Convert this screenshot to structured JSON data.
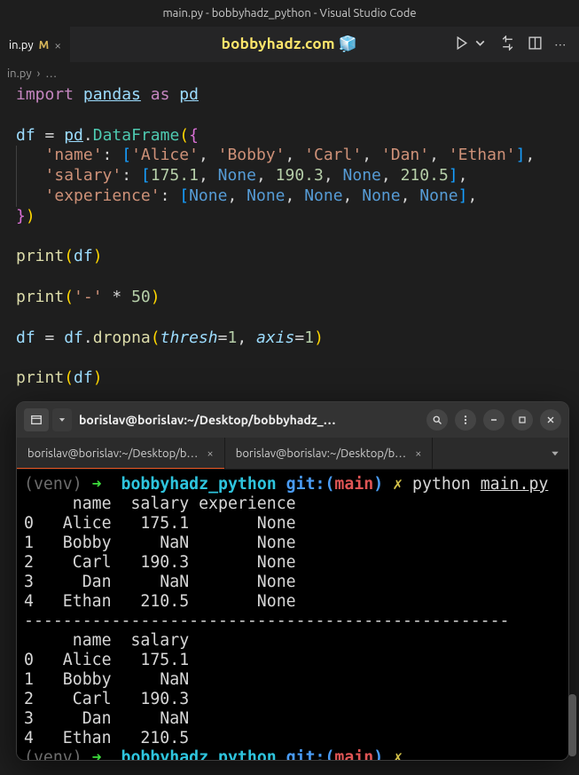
{
  "titlebar": "main.py - bobbyhadz_python - Visual Studio Code",
  "editor_tab": {
    "name": "in.py",
    "modified": "M"
  },
  "brand": {
    "text": "bobbyhadz.com",
    "emoji": "🧊"
  },
  "breadcrumb": {
    "file": "in.py",
    "sep": "›",
    "more": "…"
  },
  "code": {
    "l1_import": "import",
    "l1_pandas": "pandas",
    "l1_as": "as",
    "l1_pd": "pd",
    "l3_df": "df",
    "l3_pd": "pd",
    "l3_DataFrame": "DataFrame",
    "l4_name_key": "'name'",
    "l4_vals": [
      "'Alice'",
      "'Bobby'",
      "'Carl'",
      "'Dan'",
      "'Ethan'"
    ],
    "l5_salary_key": "'salary'",
    "l5_vals": [
      "175.1",
      "None",
      "190.3",
      "None",
      "210.5"
    ],
    "l6_exp_key": "'experience'",
    "l6_vals": [
      "None",
      "None",
      "None",
      "None",
      "None"
    ],
    "l9_print": "print",
    "l9_df": "df",
    "l11_print": "print",
    "l11_dash": "'-'",
    "l11_star": "*",
    "l11_50": "50",
    "l13_df": "df",
    "l13_dropna": "dropna",
    "l13_thresh": "thresh",
    "l13_1a": "1",
    "l13_axis": "axis",
    "l13_1b": "1",
    "l15_print": "print",
    "l15_df": "df"
  },
  "terminal": {
    "title": "borislav@borislav:~/Desktop/bobbyhadz_…",
    "tabs": [
      "borislav@borislav:~/Desktop/b…",
      "borislav@borislav:~/Desktop/b…"
    ],
    "line1": {
      "venv": "(venv)",
      "arrow": "➜",
      "dir": "bobbyhadz_python",
      "git": "git:(",
      "branch": "main",
      "gitend": ")",
      "dirty": "✗",
      "cmd": "python",
      "arg": "main.py"
    },
    "out_block1": [
      "     name  salary experience",
      "0   Alice   175.1       None",
      "1   Bobby     NaN       None",
      "2    Carl   190.3       None",
      "3     Dan     NaN       None",
      "4   Ethan   210.5       None"
    ],
    "sep": "--------------------------------------------------",
    "out_block2": [
      "     name  salary",
      "0   Alice   175.1",
      "1   Bobby     NaN",
      "2    Carl   190.3",
      "3     Dan     NaN",
      "4   Ethan   210.5"
    ],
    "line2": {
      "venv": "(venv)",
      "arrow": "➜",
      "dir": "bobbyhadz_python",
      "git": "git:(",
      "branch": "main",
      "gitend": ")",
      "dirty": "✗"
    }
  }
}
